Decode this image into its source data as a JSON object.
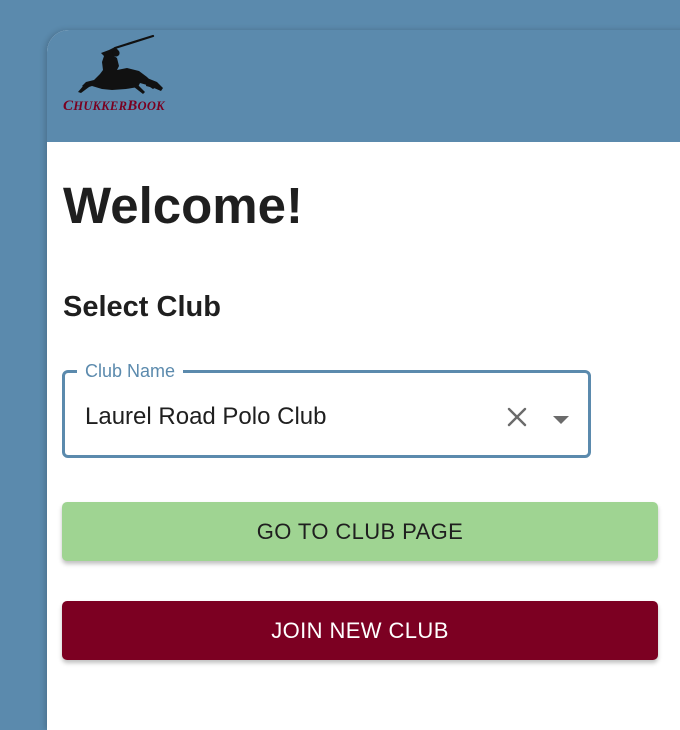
{
  "app": {
    "logo_text_first_cap": "C",
    "logo_text_rest1": "HUKKER",
    "logo_text_second_cap": "B",
    "logo_text_rest2": "OOK"
  },
  "page": {
    "title": "Welcome!",
    "section_heading": "Select Club"
  },
  "club_select": {
    "label": "Club Name",
    "value": "Laurel Road Polo Club",
    "clear_icon": "close-icon",
    "dropdown_icon": "caret-down-icon"
  },
  "actions": {
    "go_to_club_label": "GO TO CLUB PAGE",
    "join_club_label": "JOIN NEW CLUB"
  },
  "colors": {
    "background": "#5b8aad",
    "accent_green": "#9fd492",
    "brand_maroon": "#7c0022"
  }
}
